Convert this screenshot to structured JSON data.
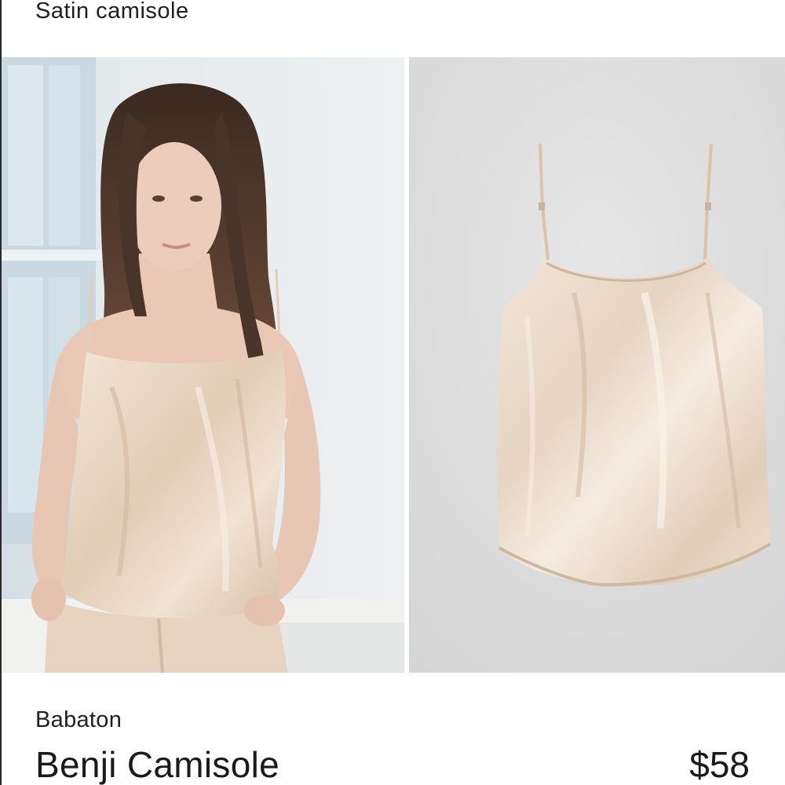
{
  "header": {
    "title": "Satin camisole"
  },
  "gallery": {
    "images": [
      {
        "alt": "model wearing satin camisole",
        "icon": "product-photo-model"
      },
      {
        "alt": "satin camisole flat lay",
        "icon": "product-photo-flat"
      }
    ]
  },
  "product": {
    "brand": "Babaton",
    "name": "Benji Camisole",
    "price": "$58"
  },
  "colors": {
    "satin": "#e9d8c6",
    "background_left": "#e7ebee",
    "background_right": "#dcdcdc"
  }
}
